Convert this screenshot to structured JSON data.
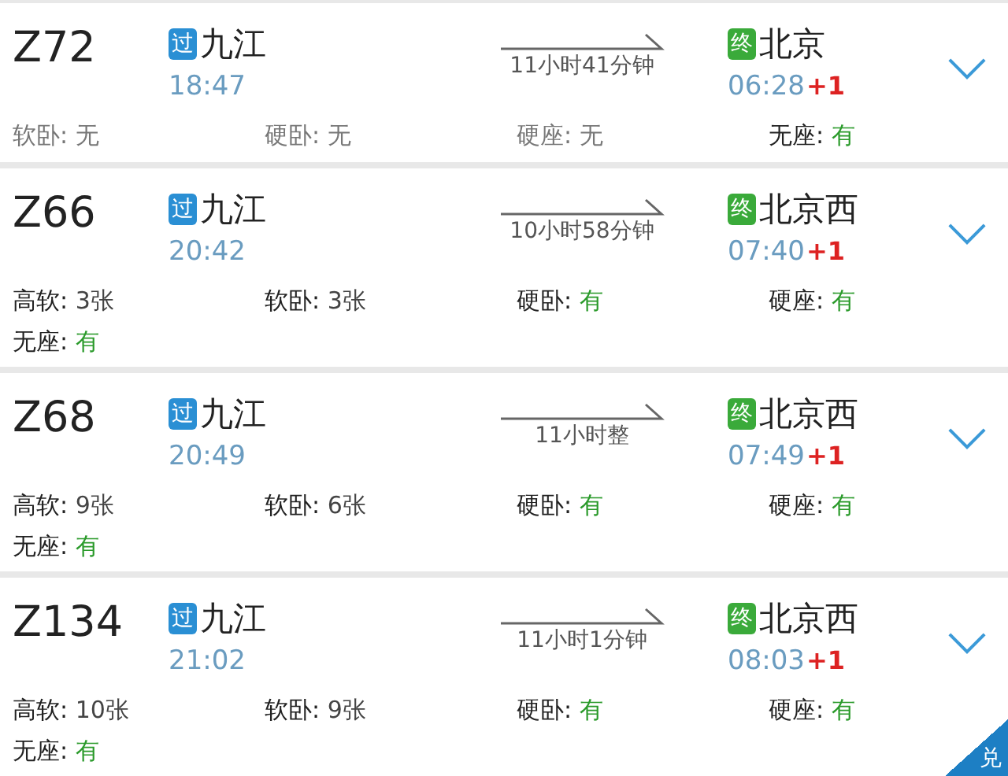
{
  "trains": [
    {
      "number": "Z72",
      "from_tag": "过",
      "from": "九江",
      "depart": "18:47",
      "duration": "11小时41分钟",
      "to_tag": "终",
      "to": "北京",
      "arrive": "06:28",
      "day_offset": "+1",
      "expanded": false,
      "seats": [
        {
          "label": "软卧:",
          "value": "无",
          "kind": "none"
        },
        {
          "label": "硬卧:",
          "value": "无",
          "kind": "none"
        },
        {
          "label": "硬座:",
          "value": "无",
          "kind": "none"
        },
        {
          "label": "无座:",
          "value": "有",
          "kind": "yes"
        }
      ]
    },
    {
      "number": "Z66",
      "from_tag": "过",
      "from": "九江",
      "depart": "20:42",
      "duration": "10小时58分钟",
      "to_tag": "终",
      "to": "北京西",
      "arrive": "07:40",
      "day_offset": "+1",
      "expanded": false,
      "seats": [
        {
          "label": "高软:",
          "value": "3张",
          "kind": "count"
        },
        {
          "label": "软卧:",
          "value": "3张",
          "kind": "count"
        },
        {
          "label": "硬卧:",
          "value": "有",
          "kind": "yes"
        },
        {
          "label": "硬座:",
          "value": "有",
          "kind": "yes"
        },
        {
          "label": "无座:",
          "value": "有",
          "kind": "yes"
        }
      ]
    },
    {
      "number": "Z68",
      "from_tag": "过",
      "from": "九江",
      "depart": "20:49",
      "duration": "11小时整",
      "to_tag": "终",
      "to": "北京西",
      "arrive": "07:49",
      "day_offset": "+1",
      "expanded": false,
      "seats": [
        {
          "label": "高软:",
          "value": "9张",
          "kind": "count"
        },
        {
          "label": "软卧:",
          "value": "6张",
          "kind": "count"
        },
        {
          "label": "硬卧:",
          "value": "有",
          "kind": "yes"
        },
        {
          "label": "硬座:",
          "value": "有",
          "kind": "yes"
        },
        {
          "label": "无座:",
          "value": "有",
          "kind": "yes"
        }
      ]
    },
    {
      "number": "Z134",
      "from_tag": "过",
      "from": "九江",
      "depart": "21:02",
      "duration": "11小时1分钟",
      "to_tag": "终",
      "to": "北京西",
      "arrive": "08:03",
      "day_offset": "+1",
      "expanded": false,
      "corner_badge": "兑",
      "seats": [
        {
          "label": "高软:",
          "value": "10张",
          "kind": "count"
        },
        {
          "label": "软卧:",
          "value": "9张",
          "kind": "count"
        },
        {
          "label": "硬卧:",
          "value": "有",
          "kind": "yes"
        },
        {
          "label": "硬座:",
          "value": "有",
          "kind": "yes"
        },
        {
          "label": "无座:",
          "value": "有",
          "kind": "yes"
        }
      ]
    }
  ]
}
